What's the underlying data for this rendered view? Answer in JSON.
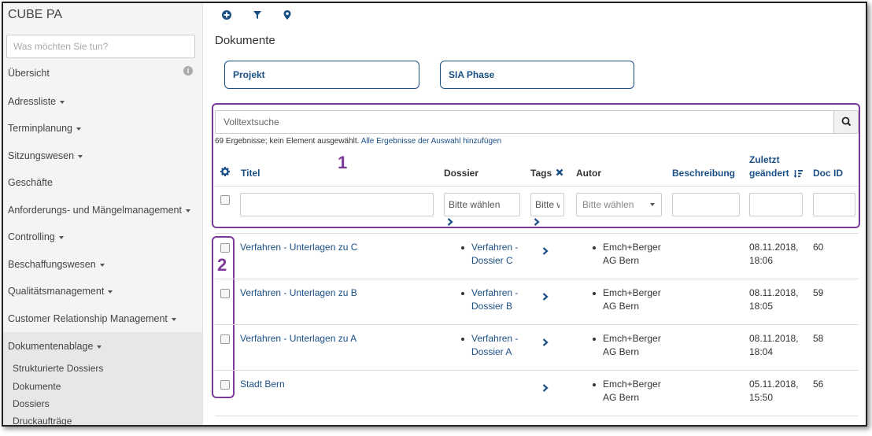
{
  "sidebar": {
    "brand": "CUBE PA",
    "search_placeholder": "Was möchten Sie tun?",
    "items": [
      {
        "label": "Übersicht"
      },
      {
        "label": "Adressliste"
      },
      {
        "label": "Terminplanung"
      },
      {
        "label": "Sitzungswesen"
      },
      {
        "label": "Geschäfte"
      },
      {
        "label": "Anforderungs- und Mängelmanagement"
      },
      {
        "label": "Controlling"
      },
      {
        "label": "Beschaffungswesen"
      },
      {
        "label": "Qualitätsmanagement"
      },
      {
        "label": "Customer Relationship Management"
      },
      {
        "label": "Dokumentenablage"
      }
    ],
    "sub_items": [
      {
        "label": "Strukturierte Dossiers"
      },
      {
        "label": "Dokumente"
      },
      {
        "label": "Dossiers"
      },
      {
        "label": "Druckaufträge"
      }
    ]
  },
  "main": {
    "title": "Dokumente",
    "filter_buttons": [
      {
        "label": "Projekt"
      },
      {
        "label": "SIA Phase"
      }
    ],
    "search_placeholder": "Volltextsuche",
    "result_text": "69 Ergebnisse; kein Element ausgewählt.",
    "result_link": "Alle Ergebnisse der Auswahl hinzufügen",
    "annotation_1": "1",
    "annotation_2": "2",
    "columns": {
      "titel": "Titel",
      "dossier": "Dossier",
      "tags": "Tags",
      "autor": "Autor",
      "beschreibung": "Beschreibung",
      "zuletzt_line1": "Zuletzt",
      "zuletzt_line2": "geändert",
      "docid": "Doc ID"
    },
    "filters": {
      "dossier_placeholder": "Bitte wählen",
      "tags_placeholder": "Bitte wählen",
      "autor_select": "Bitte wählen"
    },
    "rows": [
      {
        "title": "Verfahren - Unterlagen zu C",
        "dossier_line1": "Verfahren -",
        "dossier_line2": "Dossier C",
        "autor_line1": "Emch+Berger",
        "autor_line2": "AG Bern",
        "date_line1": "08.11.2018,",
        "date_line2": "18:06",
        "docid": "60"
      },
      {
        "title": "Verfahren - Unterlagen zu B",
        "dossier_line1": "Verfahren -",
        "dossier_line2": "Dossier B",
        "autor_line1": "Emch+Berger",
        "autor_line2": "AG Bern",
        "date_line1": "08.11.2018,",
        "date_line2": "18:05",
        "docid": "59"
      },
      {
        "title": "Verfahren - Unterlagen zu A",
        "dossier_line1": "Verfahren -",
        "dossier_line2": "Dossier A",
        "autor_line1": "Emch+Berger",
        "autor_line2": "AG Bern",
        "date_line1": "08.11.2018,",
        "date_line2": "18:04",
        "docid": "58"
      },
      {
        "title": "Stadt Bern",
        "dossier_line1": "",
        "dossier_line2": "",
        "autor_line1": "Emch+Berger",
        "autor_line2": "AG Bern",
        "date_line1": "05.11.2018,",
        "date_line2": "15:50",
        "docid": "56"
      }
    ]
  },
  "colors": {
    "link": "#1a4f85",
    "annotation": "#7b3a9a",
    "sidebar_bg": "#f4f4f4"
  },
  "icons": [
    "plus-circle-icon",
    "filter-icon",
    "map-marker-icon",
    "search-icon",
    "gear-icon",
    "close-icon",
    "sort-desc-icon",
    "chevron-right-icon",
    "info-icon",
    "caret-down-icon"
  ]
}
